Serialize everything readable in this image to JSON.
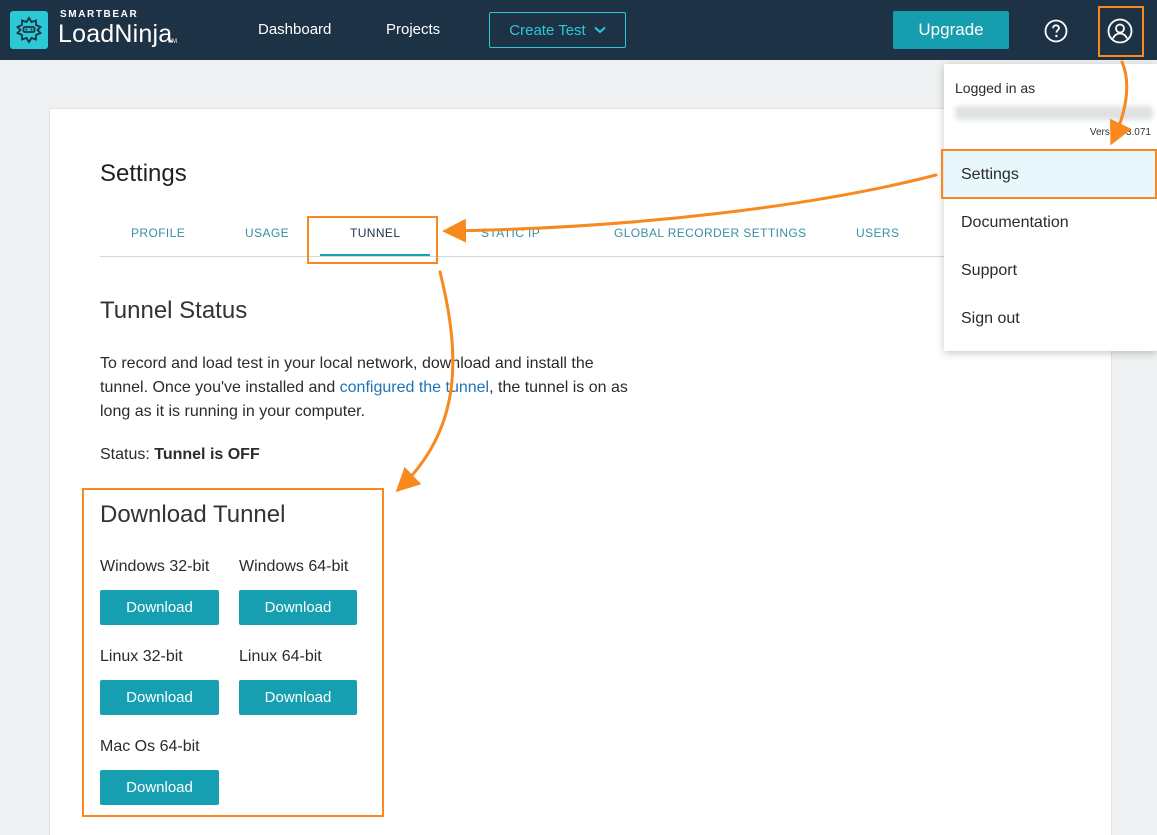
{
  "header": {
    "brand_small": "SMARTBEAR",
    "brand_product": "LoadNinja",
    "brand_sm": "SM",
    "nav": {
      "dashboard": "Dashboard",
      "projects": "Projects"
    },
    "create_test": "Create Test",
    "upgrade": "Upgrade"
  },
  "icons": {
    "logo": "loadninja-logo-icon",
    "help": "help-circle-icon",
    "user": "user-account-icon",
    "chevron": "chevron-down-icon"
  },
  "settings": {
    "title": "Settings",
    "tabs": [
      {
        "label": "PROFILE"
      },
      {
        "label": "USAGE"
      },
      {
        "label": "TUNNEL",
        "active": true
      },
      {
        "label": "STATIC IP"
      },
      {
        "label": "GLOBAL RECORDER SETTINGS"
      },
      {
        "label": "USERS"
      }
    ]
  },
  "tunnel": {
    "status_title": "Tunnel Status",
    "para_before": "To record and load test in your local network, download and install the tunnel. Once you've installed and ",
    "para_link": "configured the tunnel",
    "para_after": ", the tunnel is on as long as it is running in your computer.",
    "status_label": "Status: ",
    "status_value": "Tunnel is OFF",
    "download_title": "Download Tunnel",
    "downloads": [
      {
        "os": "Windows 32-bit",
        "button": "Download"
      },
      {
        "os": "Windows 64-bit",
        "button": "Download"
      },
      {
        "os": "Linux 32-bit",
        "button": "Download"
      },
      {
        "os": "Linux 64-bit",
        "button": "Download"
      },
      {
        "os": "Mac Os 64-bit",
        "button": "Download"
      }
    ]
  },
  "user_menu": {
    "logged_in_as": "Logged in as",
    "version": "Version 3.071",
    "items": [
      {
        "label": "Settings",
        "highlighted": true
      },
      {
        "label": "Documentation"
      },
      {
        "label": "Support"
      },
      {
        "label": "Sign out"
      }
    ]
  },
  "colors": {
    "header_bg": "#1e3246",
    "accent": "#159fb0",
    "annotation": "#f7891f",
    "link": "#1f73b7"
  }
}
